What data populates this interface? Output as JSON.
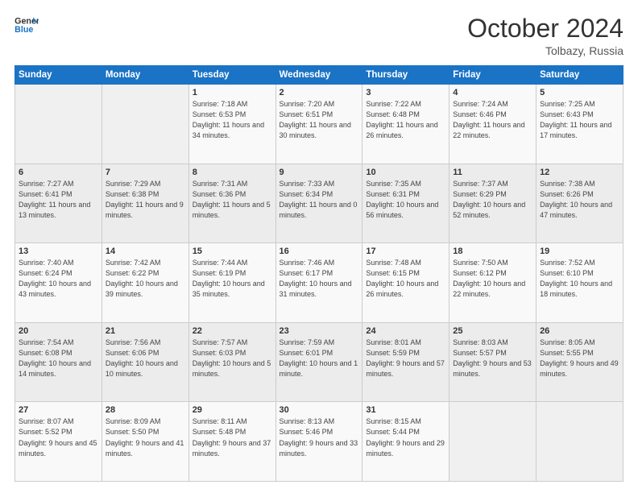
{
  "logo": {
    "line1": "General",
    "line2": "Blue"
  },
  "header": {
    "month": "October 2024",
    "location": "Tolbazy, Russia"
  },
  "weekdays": [
    "Sunday",
    "Monday",
    "Tuesday",
    "Wednesday",
    "Thursday",
    "Friday",
    "Saturday"
  ],
  "weeks": [
    [
      {
        "day": "",
        "detail": ""
      },
      {
        "day": "",
        "detail": ""
      },
      {
        "day": "1",
        "detail": "Sunrise: 7:18 AM\nSunset: 6:53 PM\nDaylight: 11 hours and 34 minutes."
      },
      {
        "day": "2",
        "detail": "Sunrise: 7:20 AM\nSunset: 6:51 PM\nDaylight: 11 hours and 30 minutes."
      },
      {
        "day": "3",
        "detail": "Sunrise: 7:22 AM\nSunset: 6:48 PM\nDaylight: 11 hours and 26 minutes."
      },
      {
        "day": "4",
        "detail": "Sunrise: 7:24 AM\nSunset: 6:46 PM\nDaylight: 11 hours and 22 minutes."
      },
      {
        "day": "5",
        "detail": "Sunrise: 7:25 AM\nSunset: 6:43 PM\nDaylight: 11 hours and 17 minutes."
      }
    ],
    [
      {
        "day": "6",
        "detail": "Sunrise: 7:27 AM\nSunset: 6:41 PM\nDaylight: 11 hours and 13 minutes."
      },
      {
        "day": "7",
        "detail": "Sunrise: 7:29 AM\nSunset: 6:38 PM\nDaylight: 11 hours and 9 minutes."
      },
      {
        "day": "8",
        "detail": "Sunrise: 7:31 AM\nSunset: 6:36 PM\nDaylight: 11 hours and 5 minutes."
      },
      {
        "day": "9",
        "detail": "Sunrise: 7:33 AM\nSunset: 6:34 PM\nDaylight: 11 hours and 0 minutes."
      },
      {
        "day": "10",
        "detail": "Sunrise: 7:35 AM\nSunset: 6:31 PM\nDaylight: 10 hours and 56 minutes."
      },
      {
        "day": "11",
        "detail": "Sunrise: 7:37 AM\nSunset: 6:29 PM\nDaylight: 10 hours and 52 minutes."
      },
      {
        "day": "12",
        "detail": "Sunrise: 7:38 AM\nSunset: 6:26 PM\nDaylight: 10 hours and 47 minutes."
      }
    ],
    [
      {
        "day": "13",
        "detail": "Sunrise: 7:40 AM\nSunset: 6:24 PM\nDaylight: 10 hours and 43 minutes."
      },
      {
        "day": "14",
        "detail": "Sunrise: 7:42 AM\nSunset: 6:22 PM\nDaylight: 10 hours and 39 minutes."
      },
      {
        "day": "15",
        "detail": "Sunrise: 7:44 AM\nSunset: 6:19 PM\nDaylight: 10 hours and 35 minutes."
      },
      {
        "day": "16",
        "detail": "Sunrise: 7:46 AM\nSunset: 6:17 PM\nDaylight: 10 hours and 31 minutes."
      },
      {
        "day": "17",
        "detail": "Sunrise: 7:48 AM\nSunset: 6:15 PM\nDaylight: 10 hours and 26 minutes."
      },
      {
        "day": "18",
        "detail": "Sunrise: 7:50 AM\nSunset: 6:12 PM\nDaylight: 10 hours and 22 minutes."
      },
      {
        "day": "19",
        "detail": "Sunrise: 7:52 AM\nSunset: 6:10 PM\nDaylight: 10 hours and 18 minutes."
      }
    ],
    [
      {
        "day": "20",
        "detail": "Sunrise: 7:54 AM\nSunset: 6:08 PM\nDaylight: 10 hours and 14 minutes."
      },
      {
        "day": "21",
        "detail": "Sunrise: 7:56 AM\nSunset: 6:06 PM\nDaylight: 10 hours and 10 minutes."
      },
      {
        "day": "22",
        "detail": "Sunrise: 7:57 AM\nSunset: 6:03 PM\nDaylight: 10 hours and 5 minutes."
      },
      {
        "day": "23",
        "detail": "Sunrise: 7:59 AM\nSunset: 6:01 PM\nDaylight: 10 hours and 1 minute."
      },
      {
        "day": "24",
        "detail": "Sunrise: 8:01 AM\nSunset: 5:59 PM\nDaylight: 9 hours and 57 minutes."
      },
      {
        "day": "25",
        "detail": "Sunrise: 8:03 AM\nSunset: 5:57 PM\nDaylight: 9 hours and 53 minutes."
      },
      {
        "day": "26",
        "detail": "Sunrise: 8:05 AM\nSunset: 5:55 PM\nDaylight: 9 hours and 49 minutes."
      }
    ],
    [
      {
        "day": "27",
        "detail": "Sunrise: 8:07 AM\nSunset: 5:52 PM\nDaylight: 9 hours and 45 minutes."
      },
      {
        "day": "28",
        "detail": "Sunrise: 8:09 AM\nSunset: 5:50 PM\nDaylight: 9 hours and 41 minutes."
      },
      {
        "day": "29",
        "detail": "Sunrise: 8:11 AM\nSunset: 5:48 PM\nDaylight: 9 hours and 37 minutes."
      },
      {
        "day": "30",
        "detail": "Sunrise: 8:13 AM\nSunset: 5:46 PM\nDaylight: 9 hours and 33 minutes."
      },
      {
        "day": "31",
        "detail": "Sunrise: 8:15 AM\nSunset: 5:44 PM\nDaylight: 9 hours and 29 minutes."
      },
      {
        "day": "",
        "detail": ""
      },
      {
        "day": "",
        "detail": ""
      }
    ]
  ]
}
